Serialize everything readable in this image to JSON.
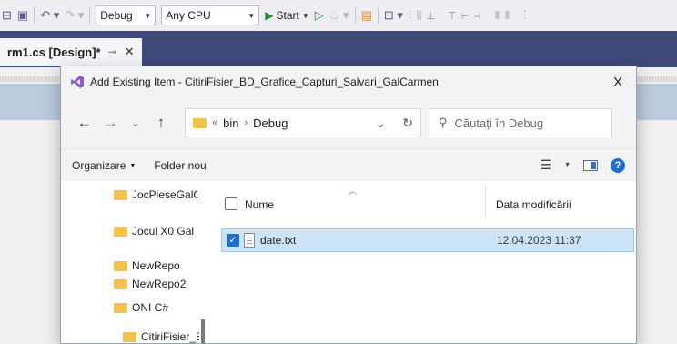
{
  "toolbar": {
    "config": "Debug",
    "platform": "Any CPU",
    "start_label": "Start"
  },
  "tab": {
    "label": "rm1.cs [Design]*"
  },
  "dialog": {
    "title": "Add Existing Item - CitiriFisier_BD_Grafice_Capturi_Salvari_GalCarmen",
    "close": "X",
    "address": {
      "chevron": "«",
      "parts": [
        "bin",
        "Debug"
      ]
    },
    "search_placeholder": "Căutați în Debug",
    "commands": {
      "organize": "Organizare",
      "new_folder": "Folder nou"
    },
    "nav_items": [
      "JocPieseGalC",
      "Jocul X0 Gal",
      "NewRepo",
      "NewRepo2",
      "ONI C#",
      "CitiriFisier_E"
    ],
    "columns": {
      "name": "Nume",
      "date": "Data modificării"
    },
    "files": [
      {
        "name": "date.txt",
        "date": "12.04.2023 11:37",
        "selected": true
      }
    ]
  },
  "colors": {
    "accent": "#1f6fd0",
    "tab_strip": "#3f4a7a",
    "selection": "#cce4f7",
    "folder": "#f2c24a"
  }
}
